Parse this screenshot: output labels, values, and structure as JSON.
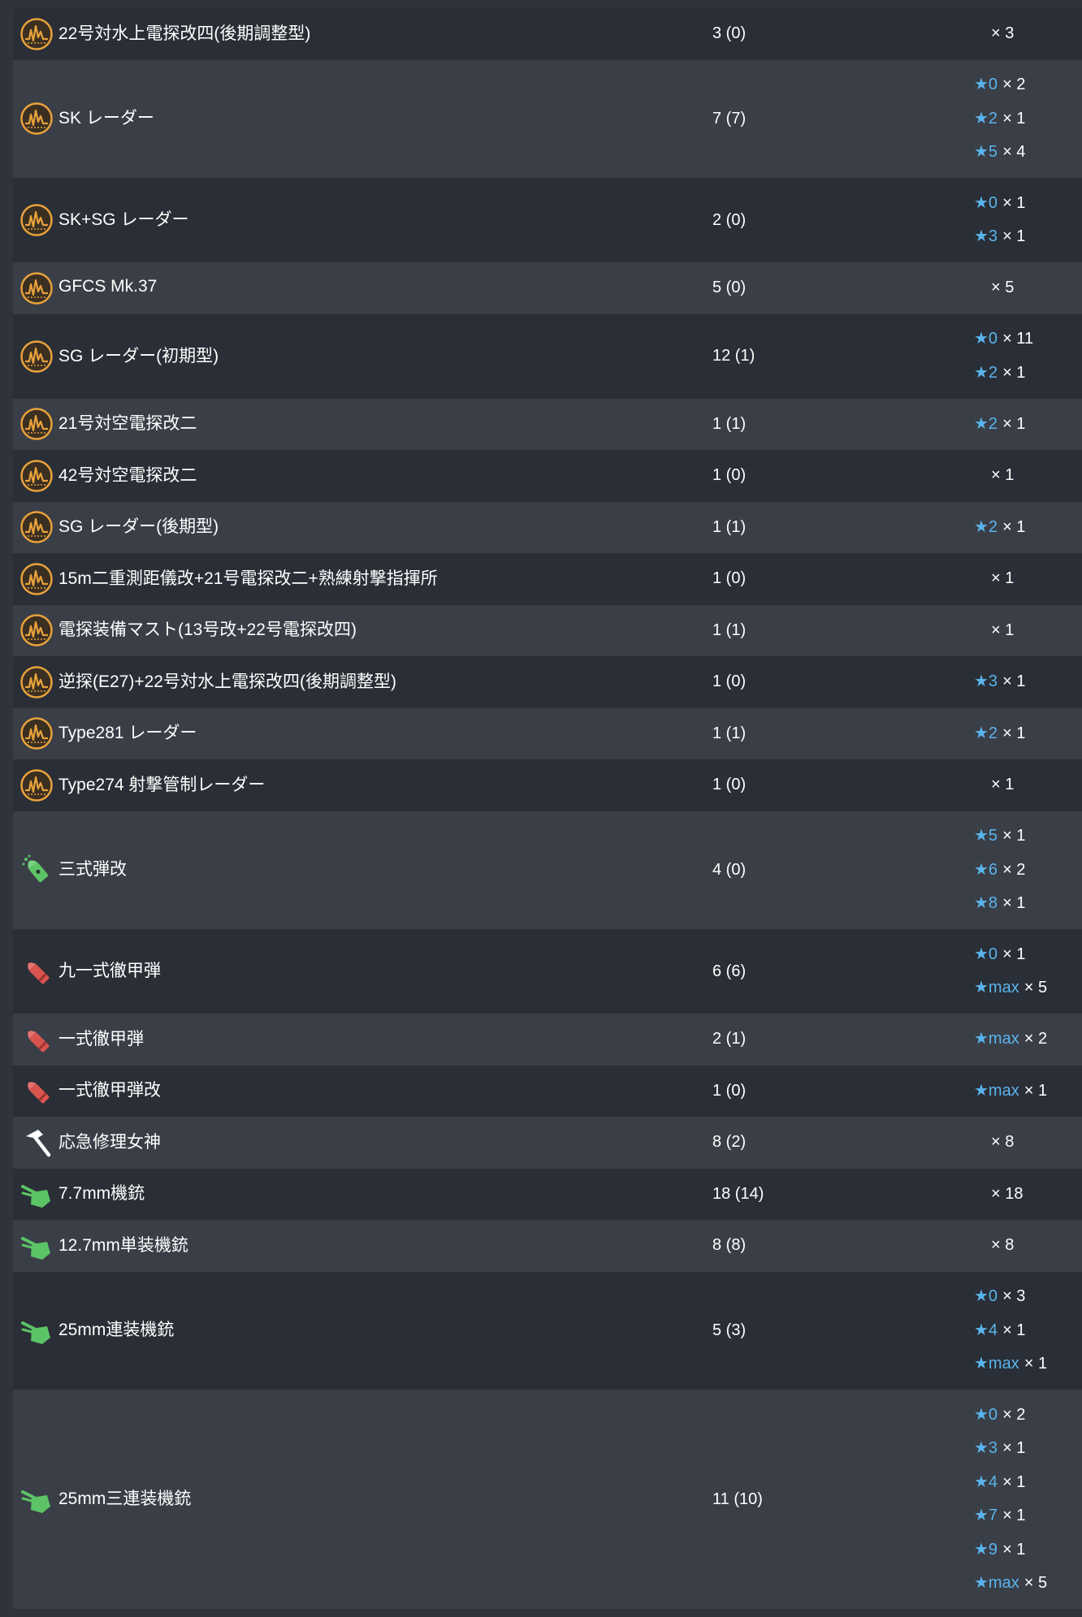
{
  "rows": [
    {
      "icon": "radar-icon",
      "name": "22号対水上電探改四(後期調整型)",
      "count": "3 (0)",
      "levels": [
        {
          "star": "",
          "mult": "× 3"
        }
      ]
    },
    {
      "icon": "radar-icon",
      "name": "SK レーダー",
      "count": "7 (7)",
      "levels": [
        {
          "star": "★0",
          "mult": "× 2"
        },
        {
          "star": "★2",
          "mult": "× 1"
        },
        {
          "star": "★5",
          "mult": "× 4"
        }
      ]
    },
    {
      "icon": "radar-icon",
      "name": "SK+SG レーダー",
      "count": "2 (0)",
      "levels": [
        {
          "star": "★0",
          "mult": "× 1"
        },
        {
          "star": "★3",
          "mult": "× 1"
        }
      ]
    },
    {
      "icon": "radar-icon",
      "name": "GFCS Mk.37",
      "count": "5 (0)",
      "levels": [
        {
          "star": "",
          "mult": "× 5"
        }
      ]
    },
    {
      "icon": "radar-icon",
      "name": "SG レーダー(初期型)",
      "count": "12 (1)",
      "levels": [
        {
          "star": "★0",
          "mult": "× 11"
        },
        {
          "star": "★2",
          "mult": "× 1"
        }
      ]
    },
    {
      "icon": "radar-icon",
      "name": "21号対空電探改二",
      "count": "1 (1)",
      "levels": [
        {
          "star": "★2",
          "mult": "× 1"
        }
      ]
    },
    {
      "icon": "radar-icon",
      "name": "42号対空電探改二",
      "count": "1 (0)",
      "levels": [
        {
          "star": "",
          "mult": "× 1"
        }
      ]
    },
    {
      "icon": "radar-icon",
      "name": "SG レーダー(後期型)",
      "count": "1 (1)",
      "levels": [
        {
          "star": "★2",
          "mult": "× 1"
        }
      ]
    },
    {
      "icon": "radar-icon",
      "name": "15m二重測距儀改+21号電探改二+熟練射撃指揮所",
      "count": "1 (0)",
      "levels": [
        {
          "star": "",
          "mult": "× 1"
        }
      ]
    },
    {
      "icon": "radar-icon",
      "name": "電探装備マスト(13号改+22号電探改四)",
      "count": "1 (1)",
      "levels": [
        {
          "star": "",
          "mult": "× 1"
        }
      ]
    },
    {
      "icon": "radar-icon",
      "name": "逆探(E27)+22号対水上電探改四(後期調整型)",
      "count": "1 (0)",
      "levels": [
        {
          "star": "★3",
          "mult": "× 1"
        }
      ]
    },
    {
      "icon": "radar-icon",
      "name": "Type281 レーダー",
      "count": "1 (1)",
      "levels": [
        {
          "star": "★2",
          "mult": "× 1"
        }
      ]
    },
    {
      "icon": "radar-icon",
      "name": "Type274 射撃管制レーダー",
      "count": "1 (0)",
      "levels": [
        {
          "star": "",
          "mult": "× 1"
        }
      ]
    },
    {
      "icon": "aa-shell-icon",
      "name": "三式弾改",
      "count": "4 (0)",
      "levels": [
        {
          "star": "★5",
          "mult": "× 1"
        },
        {
          "star": "★6",
          "mult": "× 2"
        },
        {
          "star": "★8",
          "mult": "× 1"
        }
      ]
    },
    {
      "icon": "ap-shell-icon",
      "name": "九一式徹甲弾",
      "count": "6 (6)",
      "levels": [
        {
          "star": "★0",
          "mult": "× 1"
        },
        {
          "star": "★max",
          "mult": "× 5"
        }
      ]
    },
    {
      "icon": "ap-shell-icon",
      "name": "一式徹甲弾",
      "count": "2 (1)",
      "levels": [
        {
          "star": "★max",
          "mult": "× 2"
        }
      ]
    },
    {
      "icon": "ap-shell-icon",
      "name": "一式徹甲弾改",
      "count": "1 (0)",
      "levels": [
        {
          "star": "★max",
          "mult": "× 1"
        }
      ]
    },
    {
      "icon": "repair-hammer-icon",
      "name": "応急修理女神",
      "count": "8 (2)",
      "levels": [
        {
          "star": "",
          "mult": "× 8"
        }
      ]
    },
    {
      "icon": "aa-gun-icon",
      "name": "7.7mm機銃",
      "count": "18 (14)",
      "levels": [
        {
          "star": "",
          "mult": "× 18"
        }
      ]
    },
    {
      "icon": "aa-gun-icon",
      "name": "12.7mm単装機銃",
      "count": "8 (8)",
      "levels": [
        {
          "star": "",
          "mult": "× 8"
        }
      ]
    },
    {
      "icon": "aa-gun-icon",
      "name": "25mm連装機銃",
      "count": "5 (3)",
      "levels": [
        {
          "star": "★0",
          "mult": "× 3"
        },
        {
          "star": "★4",
          "mult": "× 1"
        },
        {
          "star": "★max",
          "mult": "× 1"
        }
      ]
    },
    {
      "icon": "aa-gun-icon",
      "name": "25mm三連装機銃",
      "count": "11 (10)",
      "levels": [
        {
          "star": "★0",
          "mult": "× 2"
        },
        {
          "star": "★3",
          "mult": "× 1"
        },
        {
          "star": "★4",
          "mult": "× 1"
        },
        {
          "star": "★7",
          "mult": "× 1"
        },
        {
          "star": "★9",
          "mult": "× 1"
        },
        {
          "star": "★max",
          "mult": "× 5"
        }
      ]
    }
  ],
  "colors": {
    "row_dark": "#2a2e36",
    "row_light": "#3a3e47",
    "star": "#5ab4ec",
    "radar": "#e8a23c",
    "aa_gun": "#5cc466",
    "ap_shell": "#d9534f"
  }
}
